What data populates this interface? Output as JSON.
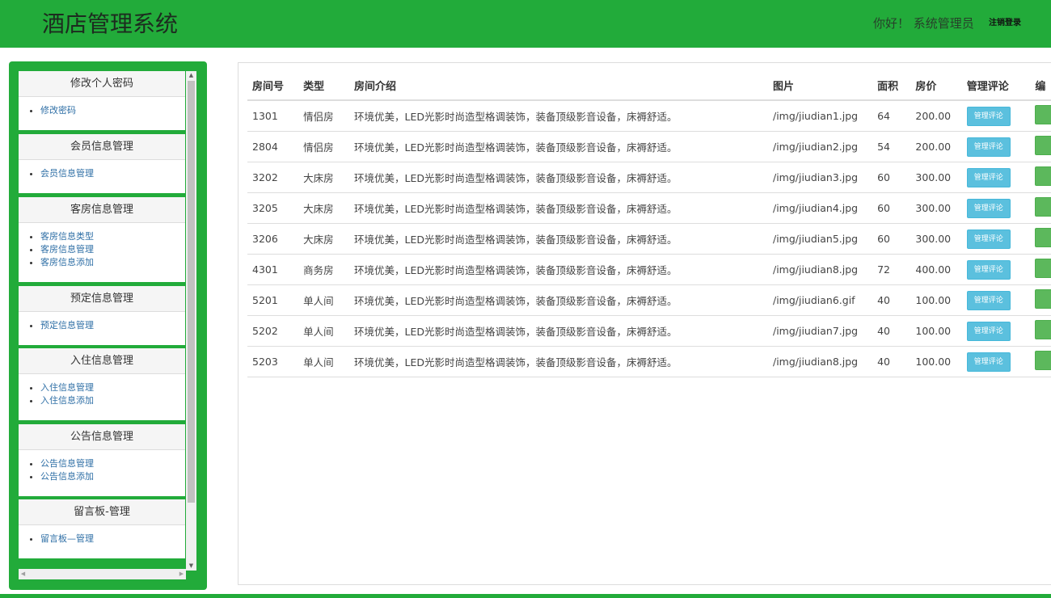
{
  "header": {
    "title": "酒店管理系统",
    "greeting": "你好！ 系统管理员",
    "logout": "注销登录"
  },
  "sidebar": {
    "panels": [
      {
        "title": "修改个人密码",
        "items": [
          "修改密码"
        ]
      },
      {
        "title": "会员信息管理",
        "items": [
          "会员信息管理"
        ]
      },
      {
        "title": "客房信息管理",
        "items": [
          "客房信息类型",
          "客房信息管理",
          "客房信息添加"
        ]
      },
      {
        "title": "预定信息管理",
        "items": [
          "预定信息管理"
        ]
      },
      {
        "title": "入住信息管理",
        "items": [
          "入住信息管理",
          "入住信息添加"
        ]
      },
      {
        "title": "公告信息管理",
        "items": [
          "公告信息管理",
          "公告信息添加"
        ]
      },
      {
        "title": "留言板-管理",
        "items": [
          "留言板—管理"
        ]
      }
    ]
  },
  "table": {
    "headers": [
      "房间号",
      "类型",
      "房间介绍",
      "图片",
      "面积",
      "房价",
      "管理评论",
      "编"
    ],
    "review_button": "管理评论",
    "rows": [
      {
        "room": "1301",
        "type": "情侣房",
        "desc": "环境优美，LED光影时尚造型格调装饰，装备顶级影音设备，床褥舒适。",
        "image": "/img/jiudian1.jpg",
        "area": "64",
        "price": "200.00"
      },
      {
        "room": "2804",
        "type": "情侣房",
        "desc": "环境优美，LED光影时尚造型格调装饰，装备顶级影音设备，床褥舒适。",
        "image": "/img/jiudian2.jpg",
        "area": "54",
        "price": "200.00"
      },
      {
        "room": "3202",
        "type": "大床房",
        "desc": "环境优美，LED光影时尚造型格调装饰，装备顶级影音设备，床褥舒适。",
        "image": "/img/jiudian3.jpg",
        "area": "60",
        "price": "300.00"
      },
      {
        "room": "3205",
        "type": "大床房",
        "desc": "环境优美，LED光影时尚造型格调装饰，装备顶级影音设备，床褥舒适。",
        "image": "/img/jiudian4.jpg",
        "area": "60",
        "price": "300.00"
      },
      {
        "room": "3206",
        "type": "大床房",
        "desc": "环境优美，LED光影时尚造型格调装饰，装备顶级影音设备，床褥舒适。",
        "image": "/img/jiudian5.jpg",
        "area": "60",
        "price": "300.00"
      },
      {
        "room": "4301",
        "type": "商务房",
        "desc": "环境优美，LED光影时尚造型格调装饰，装备顶级影音设备，床褥舒适。",
        "image": "/img/jiudian8.jpg",
        "area": "72",
        "price": "400.00"
      },
      {
        "room": "5201",
        "type": "单人间",
        "desc": "环境优美，LED光影时尚造型格调装饰，装备顶级影音设备，床褥舒适。",
        "image": "/img/jiudian6.gif",
        "area": "40",
        "price": "100.00"
      },
      {
        "room": "5202",
        "type": "单人间",
        "desc": "环境优美，LED光影时尚造型格调装饰，装备顶级影音设备，床褥舒适。",
        "image": "/img/jiudian7.jpg",
        "area": "40",
        "price": "100.00"
      },
      {
        "room": "5203",
        "type": "单人间",
        "desc": "环境优美，LED光影时尚造型格调装饰，装备顶级影音设备，床褥舒适。",
        "image": "/img/jiudian8.jpg",
        "area": "40",
        "price": "100.00"
      }
    ]
  },
  "colors": {
    "brand_green": "#22ab3a",
    "info_button": "#5bc0de",
    "success_button": "#5cb85c",
    "link": "#2f6fa6"
  }
}
